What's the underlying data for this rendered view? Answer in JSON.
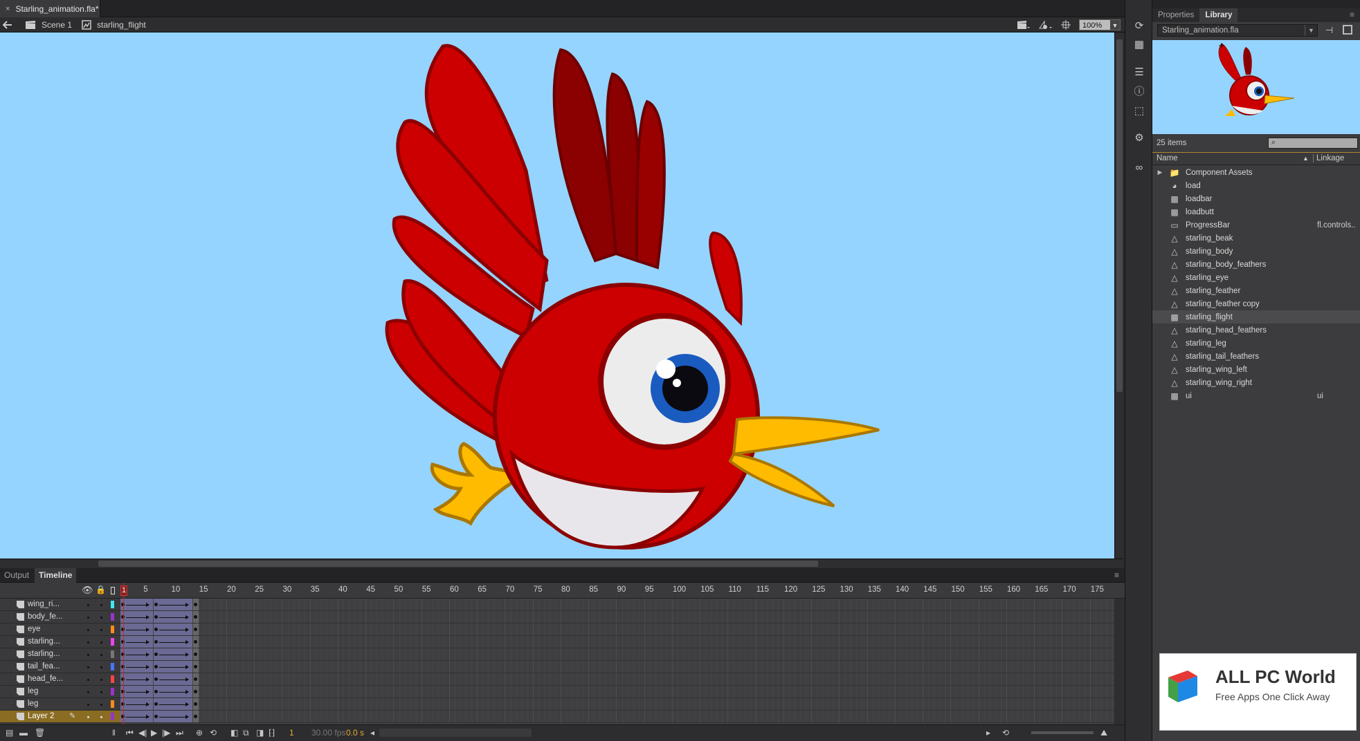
{
  "document": {
    "tab_label": "Starling_animation.fla*",
    "close_icon": "×"
  },
  "edit_bar": {
    "scene_label": "Scene 1",
    "symbol_label": "starling_flight",
    "zoom_value": "100%"
  },
  "stage": {
    "background_color": "#95d4ff"
  },
  "right_panel": {
    "tabs": [
      {
        "label": "Properties"
      },
      {
        "label": "Library"
      }
    ],
    "active_tab": "Library",
    "library": {
      "file_select": "Starling_animation.fla",
      "item_count": "25 items",
      "search_placeholder": "",
      "columns": {
        "name": "Name",
        "linkage": "Linkage"
      },
      "items": [
        {
          "name": "Component Assets",
          "type": "folder",
          "linkage": ""
        },
        {
          "name": "load",
          "type": "button",
          "linkage": ""
        },
        {
          "name": "loadbar",
          "type": "movieclip",
          "linkage": ""
        },
        {
          "name": "loadbutt",
          "type": "movieclip",
          "linkage": ""
        },
        {
          "name": "ProgressBar",
          "type": "component",
          "linkage": "fl.controls.."
        },
        {
          "name": "starling_beak",
          "type": "graphic",
          "linkage": ""
        },
        {
          "name": "starling_body",
          "type": "graphic",
          "linkage": ""
        },
        {
          "name": "starling_body_feathers",
          "type": "graphic",
          "linkage": ""
        },
        {
          "name": "starling_eye",
          "type": "graphic",
          "linkage": ""
        },
        {
          "name": "starling_feather",
          "type": "graphic",
          "linkage": ""
        },
        {
          "name": "starling_feather copy",
          "type": "graphic",
          "linkage": ""
        },
        {
          "name": "starling_flight",
          "type": "movieclip",
          "linkage": "",
          "selected": true
        },
        {
          "name": "starling_head_feathers",
          "type": "graphic",
          "linkage": ""
        },
        {
          "name": "starling_leg",
          "type": "graphic",
          "linkage": ""
        },
        {
          "name": "starling_tail_feathers",
          "type": "graphic",
          "linkage": ""
        },
        {
          "name": "starling_wing_left",
          "type": "graphic",
          "linkage": ""
        },
        {
          "name": "starling_wing_right",
          "type": "graphic",
          "linkage": ""
        },
        {
          "name": "ui",
          "type": "movieclip",
          "linkage": "ui"
        }
      ]
    }
  },
  "bottom_panel": {
    "tabs": [
      {
        "label": "Output"
      },
      {
        "label": "Timeline"
      }
    ],
    "active_tab": "Timeline",
    "timeline": {
      "frame_ticks": [
        "1",
        "5",
        "10",
        "15",
        "20",
        "25",
        "30",
        "35",
        "40",
        "45",
        "50",
        "55",
        "60",
        "65",
        "70",
        "75",
        "80",
        "85",
        "90",
        "95",
        "100",
        "105",
        "110",
        "115",
        "120",
        "125",
        "130",
        "135",
        "140",
        "145",
        "150",
        "155",
        "160",
        "165",
        "170",
        "175"
      ],
      "current_frame": "1",
      "fps": "30.00 fps",
      "elapsed": "0.0 s",
      "layers": [
        {
          "name": "wing_ri...",
          "color": "#3ee8f0"
        },
        {
          "name": "body_fe...",
          "color": "#9933cc"
        },
        {
          "name": "eye",
          "color": "#ff8c1a"
        },
        {
          "name": "starling...",
          "color": "#ee44ee"
        },
        {
          "name": "starling...",
          "color": "#777777"
        },
        {
          "name": "tail_fea...",
          "color": "#4477ff"
        },
        {
          "name": "head_fe...",
          "color": "#ff4444"
        },
        {
          "name": "leg",
          "color": "#9933cc"
        },
        {
          "name": "leg",
          "color": "#ff8c1a"
        },
        {
          "name": "Layer 2",
          "color": "#9933cc",
          "selected": true
        }
      ]
    }
  },
  "watermark": {
    "title": "ALL PC World",
    "subtitle": "Free Apps One Click Away"
  }
}
